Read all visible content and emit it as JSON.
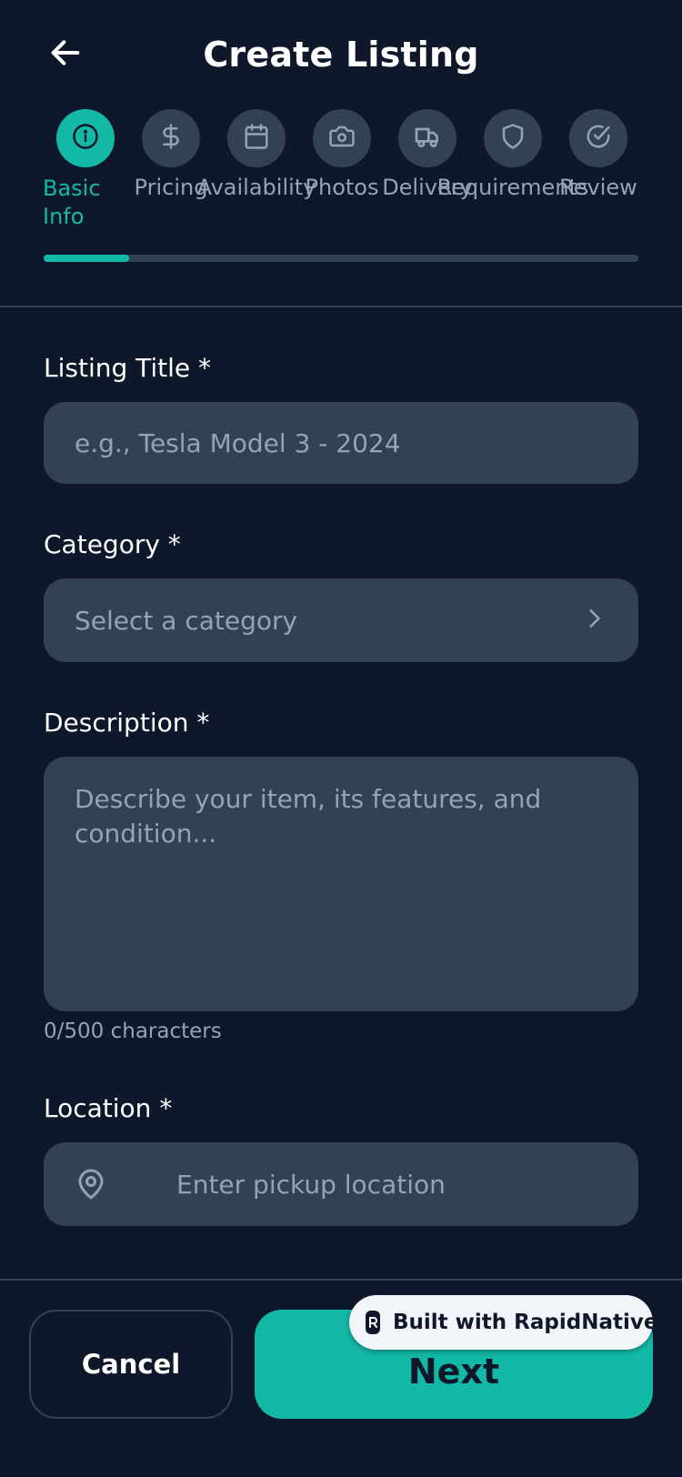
{
  "header": {
    "title": "Create Listing",
    "back_icon": "arrow-left-icon"
  },
  "steps": [
    {
      "label": "Basic Info",
      "icon": "info-icon",
      "active": true
    },
    {
      "label": "Pricing",
      "icon": "dollar-icon",
      "active": false
    },
    {
      "label": "Availability",
      "icon": "calendar-icon",
      "active": false
    },
    {
      "label": "Photos",
      "icon": "camera-icon",
      "active": false
    },
    {
      "label": "Delivery",
      "icon": "truck-icon",
      "active": false
    },
    {
      "label": "Requirements",
      "icon": "shield-icon",
      "active": false
    },
    {
      "label": "Review",
      "icon": "check-circle-icon",
      "active": false
    }
  ],
  "progress": {
    "value": 0.143
  },
  "form": {
    "title": {
      "label": "Listing Title *",
      "placeholder": "e.g., Tesla Model 3 - 2024",
      "value": ""
    },
    "category": {
      "label": "Category *",
      "placeholder": "Select a category",
      "value": ""
    },
    "description": {
      "label": "Description *",
      "placeholder": "Describe your item, its features, and condition...",
      "value": "",
      "counter": "0/500 characters"
    },
    "location": {
      "label": "Location *",
      "placeholder": "Enter pickup location",
      "value": ""
    }
  },
  "footer": {
    "cancel_label": "Cancel",
    "next_label": "Next",
    "badge_text": "Built with RapidNative"
  },
  "colors": {
    "background": "#0f172a",
    "surface": "#334155",
    "accent": "#14b8a6",
    "muted_text": "#94a3b8",
    "text": "#ffffff"
  }
}
